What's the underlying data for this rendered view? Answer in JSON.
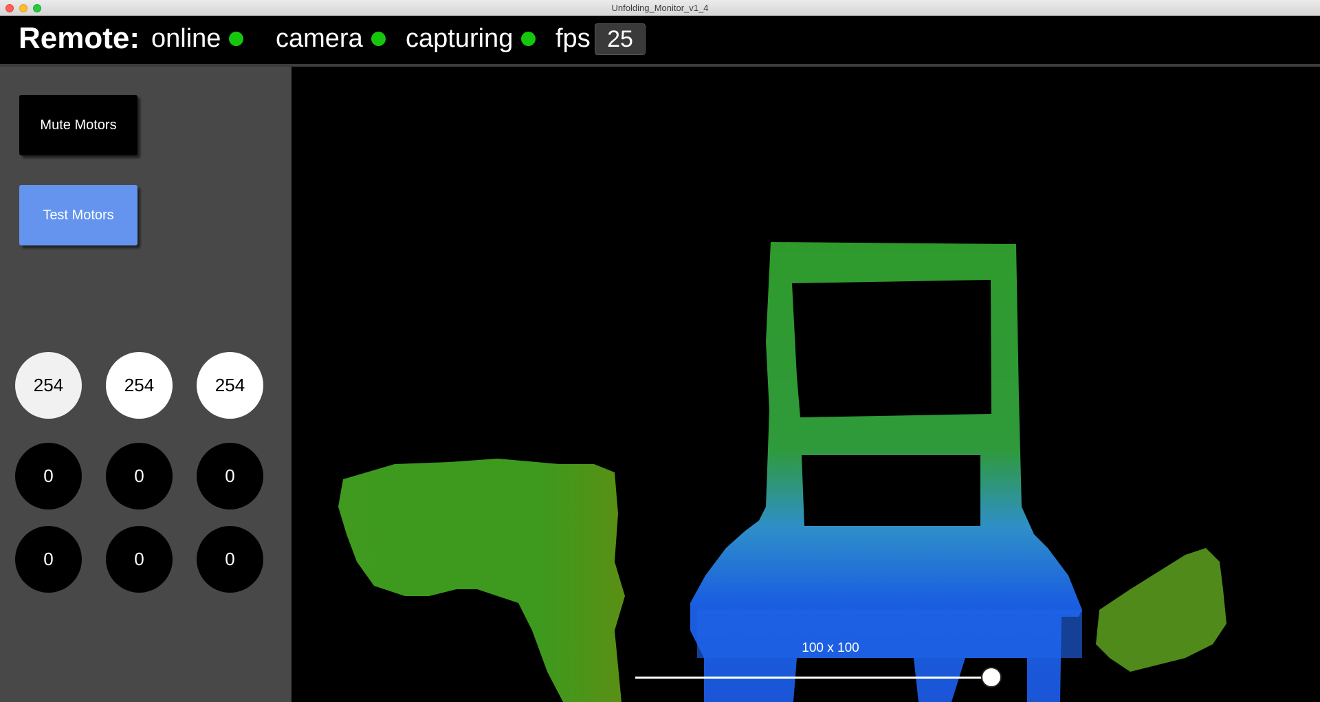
{
  "window": {
    "title": "Unfolding_Monitor_v1_4"
  },
  "status": {
    "remote_label": "Remote:",
    "online_label": "online",
    "camera_label": "camera",
    "capturing_label": "capturing",
    "fps_label": "fps",
    "fps_value": "25",
    "indicator_color": "#16c60c"
  },
  "sidebar": {
    "mute_button": "Mute Motors",
    "test_button": "Test Motors",
    "motors": [
      [
        "254",
        "254",
        "254"
      ],
      [
        "0",
        "0",
        "0"
      ],
      [
        "0",
        "0",
        "0"
      ]
    ]
  },
  "camera": {
    "resolution_label": "100 x 100",
    "slider_value": 1.0,
    "colors": {
      "near": "#1a5fe0",
      "far": "#4c9a1a"
    }
  }
}
